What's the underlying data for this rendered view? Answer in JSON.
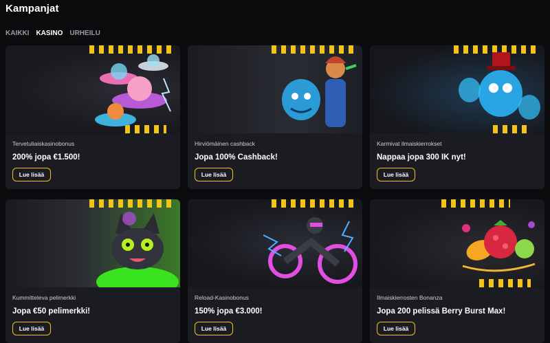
{
  "page": {
    "title": "Kampanjat"
  },
  "filters": [
    {
      "label": "KAIKKI",
      "active": false
    },
    {
      "label": "KASINO",
      "active": true
    },
    {
      "label": "URHEILU",
      "active": false
    }
  ],
  "button_label": "Lue lisää",
  "cards": [
    {
      "subtitle": "Tervetuliaiskasinobonus",
      "title": "200% jopa €1.500!"
    },
    {
      "subtitle": "Hirviömäinen cashback",
      "title": "Jopa 100% Cashback!"
    },
    {
      "subtitle": "Karmivat ilmaiskierrokset",
      "title": "Nappaa jopa 300 IK nyt!"
    },
    {
      "subtitle": "Kummitteleva pelimerkki",
      "title": "Jopa €50 pelimerkki!"
    },
    {
      "subtitle": "Reload-Kasinobonus",
      "title": "150% jopa €3.000!"
    },
    {
      "subtitle": "Ilmaiskierrosten Bonanza",
      "title": "Jopa 200 pelissä Berry Burst Max!"
    }
  ],
  "colors": {
    "accent": "#f3c319",
    "background": "#0b0b0e",
    "card": "#1b1b22"
  }
}
